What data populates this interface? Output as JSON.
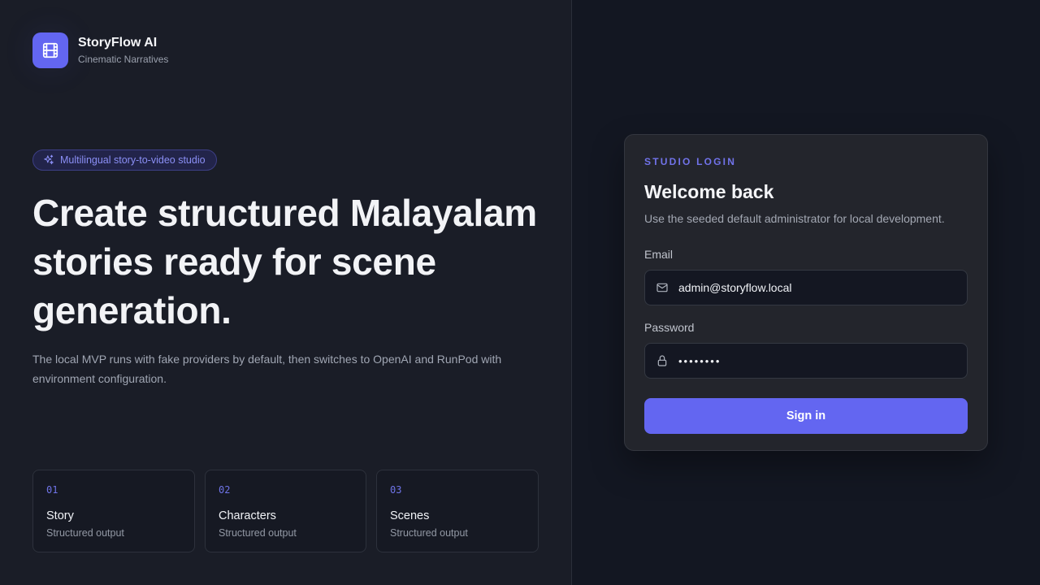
{
  "brand": {
    "name": "StoryFlow AI",
    "tagline": "Cinematic Narratives",
    "logo_icon": "film-icon",
    "accent_color": "#6366f1"
  },
  "hero": {
    "pill_icon": "sparkles-icon",
    "pill_label": "Multilingual story-to-video studio",
    "headline": "Create structured Malayalam stories ready for scene generation.",
    "description": "The local MVP runs with fake providers by default, then switches to OpenAI and RunPod with environment configuration."
  },
  "cards": [
    {
      "number": "01",
      "title": "Story",
      "subtitle": "Structured output"
    },
    {
      "number": "02",
      "title": "Characters",
      "subtitle": "Structured output"
    },
    {
      "number": "03",
      "title": "Scenes",
      "subtitle": "Structured output"
    }
  ],
  "login": {
    "eyebrow": "STUDIO LOGIN",
    "title": "Welcome back",
    "description": "Use the seeded default administrator for local development.",
    "email_label": "Email",
    "email_value": "admin@storyflow.local",
    "email_icon": "mail-icon",
    "password_label": "Password",
    "password_value": "password",
    "password_icon": "lock-icon",
    "submit_label": "Sign in"
  }
}
